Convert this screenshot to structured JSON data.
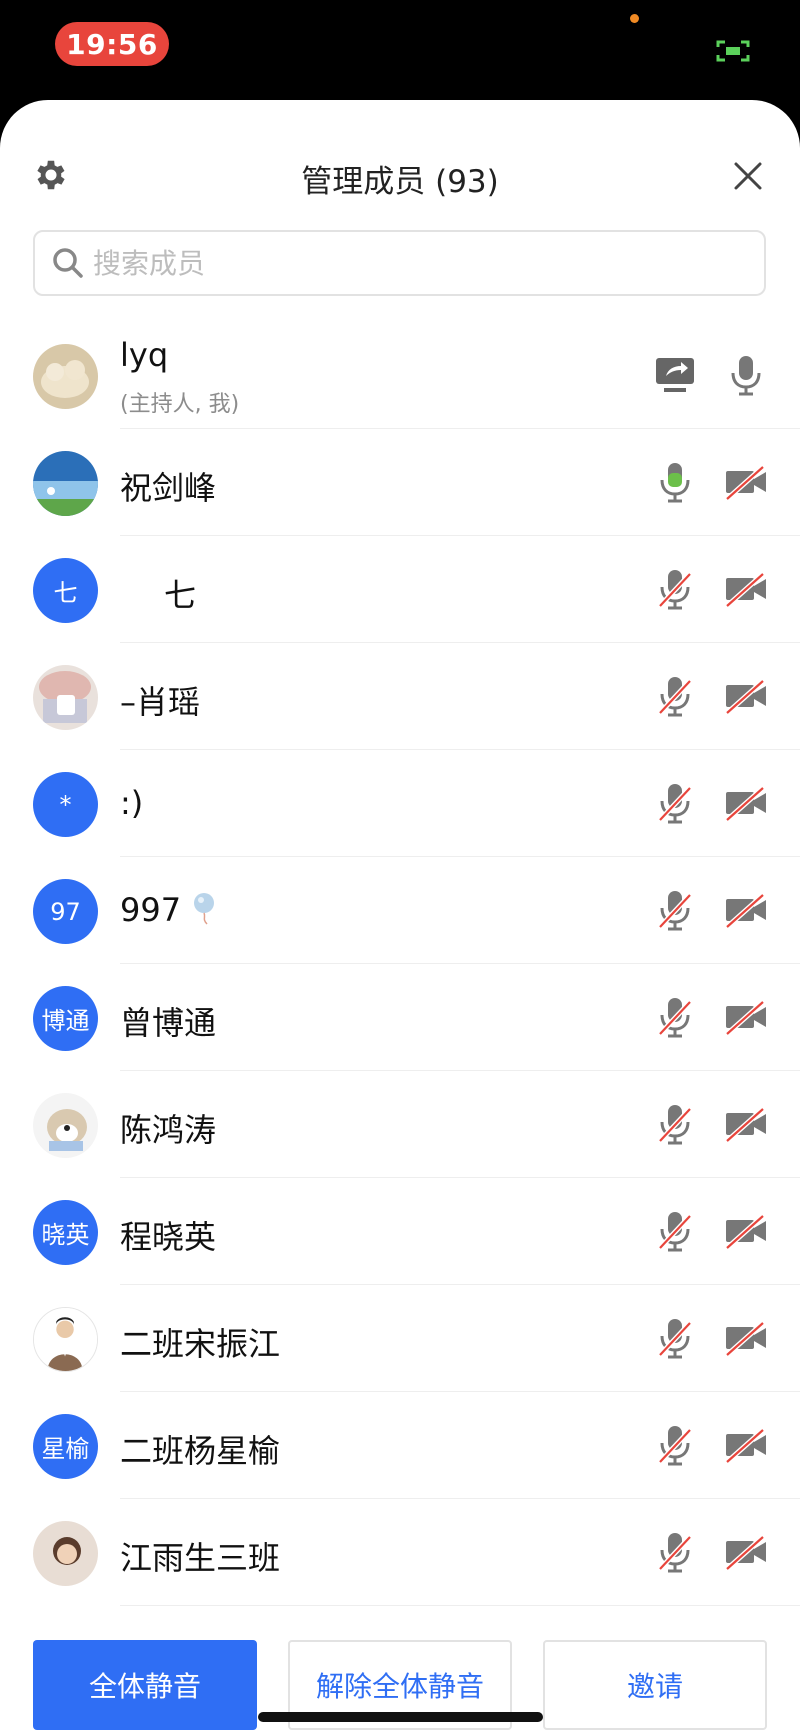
{
  "status_bar": {
    "time": "19:56"
  },
  "header": {
    "title": "管理成员 (93)"
  },
  "search": {
    "placeholder": "搜索成员"
  },
  "members": [
    {
      "name": "lyq",
      "sub": "(主持人, 我)",
      "avatar": "photo",
      "icon_a": "share-screen-icon",
      "icon_b": "mic-icon"
    },
    {
      "name": "祝剑峰",
      "avatar": "photo",
      "icon_a": "mic-active-icon",
      "icon_b": "camera-off-icon"
    },
    {
      "name": "七",
      "avatar_text": "七",
      "avatar": "initial",
      "icon_a": "mic-off-icon",
      "icon_b": "camera-off-icon"
    },
    {
      "name": "–肖瑶",
      "avatar": "photo",
      "icon_a": "mic-off-icon",
      "icon_b": "camera-off-icon"
    },
    {
      "name": ":)",
      "avatar_text": "*",
      "avatar": "initial",
      "icon_a": "mic-off-icon",
      "icon_b": "camera-off-icon"
    },
    {
      "name": "997",
      "avatar_text": "97",
      "avatar": "initial",
      "icon_a": "mic-off-icon",
      "icon_b": "camera-off-icon"
    },
    {
      "name": "曾博通",
      "avatar_text": "博通",
      "avatar": "initial",
      "icon_a": "mic-off-icon",
      "icon_b": "camera-off-icon"
    },
    {
      "name": "陈鸿涛",
      "avatar": "photo",
      "icon_a": "mic-off-icon",
      "icon_b": "camera-off-icon"
    },
    {
      "name": "程晓英",
      "avatar_text": "晓英",
      "avatar": "initial",
      "icon_a": "mic-off-icon",
      "icon_b": "camera-off-icon"
    },
    {
      "name": "二班宋振江",
      "avatar": "photo",
      "icon_a": "mic-off-icon",
      "icon_b": "camera-off-icon"
    },
    {
      "name": "二班杨星榆",
      "avatar_text": "星榆",
      "avatar": "initial",
      "icon_a": "mic-off-icon",
      "icon_b": "camera-off-icon"
    },
    {
      "name": "江雨生三班",
      "avatar": "photo",
      "icon_a": "mic-off-icon",
      "icon_b": "camera-off-icon"
    }
  ],
  "buttons": {
    "mute_all": "全体静音",
    "unmute_all": "解除全体静音",
    "invite": "邀请"
  },
  "colors": {
    "accent": "#2f6ef4",
    "mic_active": "#6cc04a",
    "muted_slash": "#e8453c",
    "time_pill": "#e8453c"
  }
}
